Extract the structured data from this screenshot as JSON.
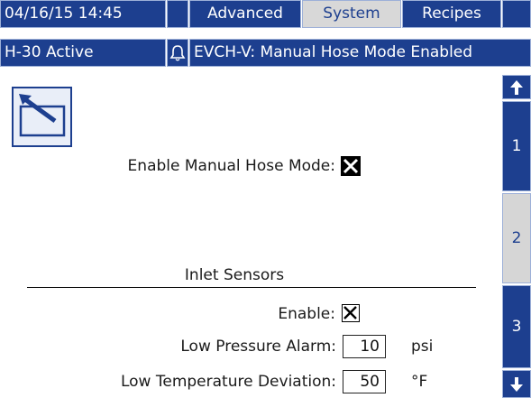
{
  "header": {
    "datetime": "04/16/15 14:45",
    "tabs": [
      {
        "label": "Advanced",
        "active": false
      },
      {
        "label": "System",
        "active": true
      },
      {
        "label": "Recipes",
        "active": false
      }
    ]
  },
  "status": {
    "active_label": "H-30 Active",
    "alarm_text": "EVCH-V: Manual Hose Mode Enabled"
  },
  "form": {
    "manual_hose_label": "Enable Manual Hose Mode:",
    "manual_hose_checked": true,
    "inlet_section_title": "Inlet Sensors",
    "enable_label": "Enable:",
    "enable_checked": true,
    "low_pressure_label": "Low Pressure Alarm:",
    "low_pressure_value": "10",
    "low_pressure_unit": "psi",
    "low_temp_label": "Low Temperature Deviation:",
    "low_temp_value": "50",
    "low_temp_unit": "°F"
  },
  "side_nav": {
    "pages": [
      "1",
      "2",
      "3"
    ],
    "active_page": "2"
  },
  "colors": {
    "bar_blue": "#1d3f8f",
    "active_gray": "#d6d6d6"
  },
  "icons": [
    "exit-screen-icon",
    "bell-icon",
    "arrow-up-icon",
    "arrow-down-icon",
    "checkbox-checked-icon"
  ]
}
